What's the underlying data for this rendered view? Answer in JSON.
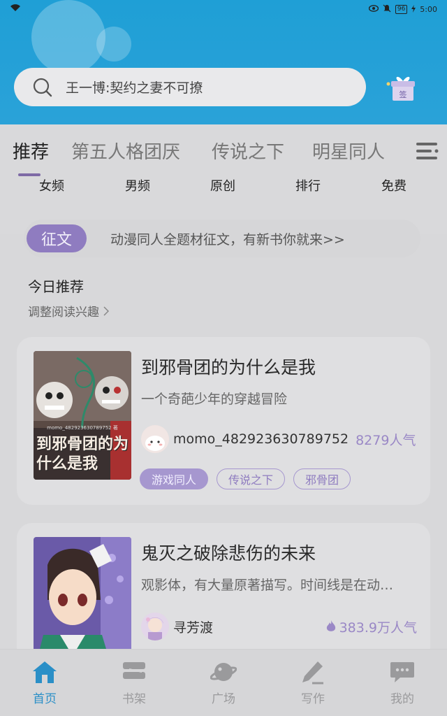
{
  "status_bar": {
    "battery": "96",
    "time": "5:00"
  },
  "search": {
    "placeholder": "王一博:契约之妻不可撩"
  },
  "sign_label": "签",
  "tabs": [
    "推荐",
    "第五人格团厌",
    "传说之下",
    "明星同人"
  ],
  "subtabs": [
    "女频",
    "男频",
    "原创",
    "排行",
    "免费"
  ],
  "notice": {
    "badge": "征文",
    "text": "动漫同人全题材征文，有新书你就来>>"
  },
  "today": {
    "title": "今日推荐",
    "adjust": "调整阅读兴趣"
  },
  "books": [
    {
      "title": "到邪骨团的为什么是我",
      "desc": "一个奇葩少年的穿越冒险",
      "author": "momo_482923630789752",
      "popularity": "8279人气",
      "cover_text": "到邪骨团的为什么是我",
      "cover_small": "momo_482923630789752 著",
      "tags": [
        "游戏同人",
        "传说之下",
        "邪骨团"
      ]
    },
    {
      "title": "鬼灭之破除悲伤的未来",
      "desc": "观影体，有大量原著描写。时间线是在动…",
      "author": "寻芳渡",
      "popularity": "383.9万人气"
    }
  ],
  "nav": [
    "首页",
    "书架",
    "广场",
    "写作",
    "我的"
  ],
  "colors": {
    "accent": "#8f7cc0",
    "header": "#1f9fd6",
    "nav_active": "#2a8fc7"
  }
}
